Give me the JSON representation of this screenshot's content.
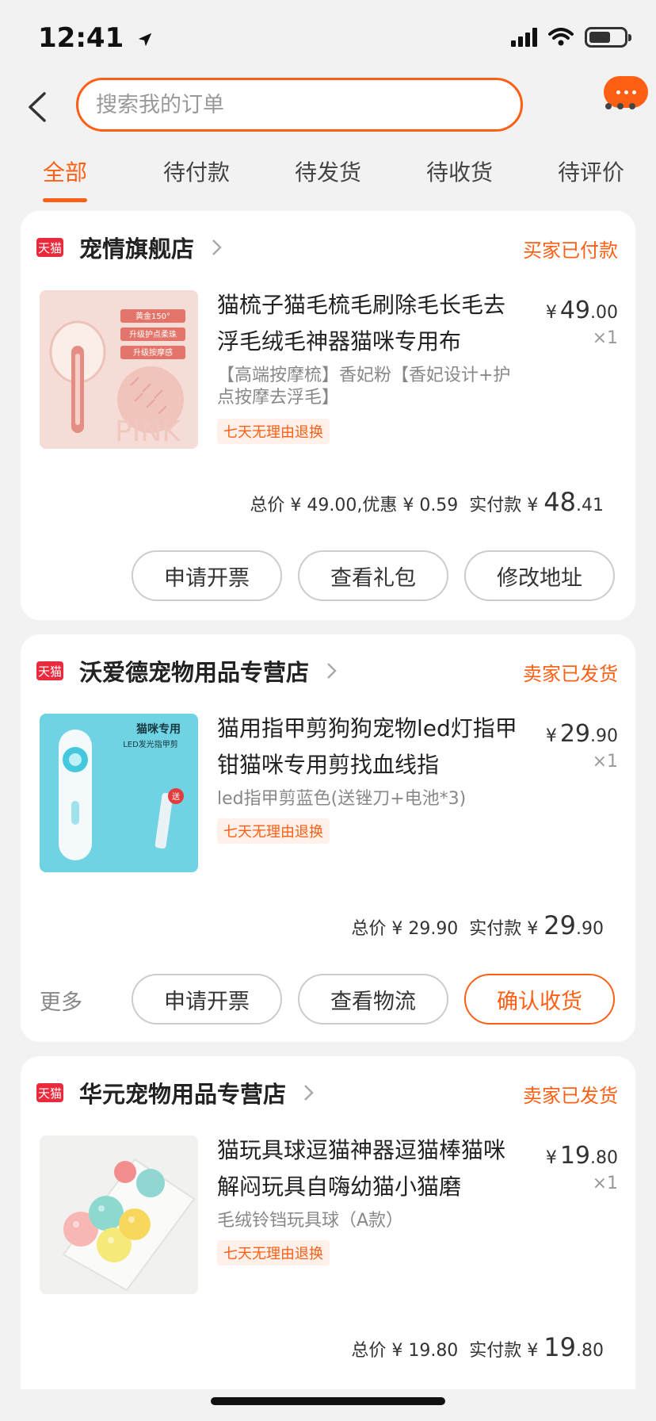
{
  "status_bar": {
    "time": "12:41"
  },
  "search": {
    "placeholder": "搜索我的订单"
  },
  "tabs": [
    {
      "label": "全部",
      "active": true
    },
    {
      "label": "待付款",
      "active": false
    },
    {
      "label": "待发货",
      "active": false
    },
    {
      "label": "待收货",
      "active": false
    },
    {
      "label": "待评价",
      "active": false
    }
  ],
  "tmall_badge": "天猫",
  "orders": [
    {
      "shop_name": "宠情旗舰店",
      "status": "买家已付款",
      "product_title": "猫梳子猫毛梳毛刷除毛长毛去浮毛绒毛神器猫咪专用布",
      "product_spec": "【高端按摩梳】香妃粉【香妃设计+护点按摩去浮毛】",
      "return_policy": "七天无理由退换",
      "price_currency": "¥",
      "price_int": "49",
      "price_dec": ".00",
      "quantity": "×1",
      "total_text": "总价 ¥ 49.00,优惠 ¥ 0.59  实付款 ¥ ",
      "paid_int": "48",
      "paid_dec": ".41",
      "actions": [
        "申请开票",
        "查看礼包",
        "修改地址"
      ],
      "image_labels": [
        "黄金150°",
        "升级护点柔珠",
        "升级按摩感",
        "PINK"
      ]
    },
    {
      "shop_name": "沃爱德宠物用品专营店",
      "status": "卖家已发货",
      "product_title": "猫用指甲剪狗狗宠物led灯指甲钳猫咪专用剪找血线指",
      "product_spec": "led指甲剪蓝色(送锉刀+电池*3)",
      "return_policy": "七天无理由退换",
      "price_currency": "¥",
      "price_int": "29",
      "price_dec": ".90",
      "quantity": "×1",
      "total_text": "总价 ¥ 29.90  实付款 ¥ ",
      "paid_int": "29",
      "paid_dec": ".90",
      "more_label": "更多",
      "actions": [
        "申请开票",
        "查看物流",
        "确认收货"
      ],
      "image_labels": [
        "猫咪专用",
        "LED发光指甲剪",
        "送"
      ]
    },
    {
      "shop_name": "华元宠物用品专营店",
      "status": "卖家已发货",
      "product_title": "猫玩具球逗猫神器逗猫棒猫咪解闷玩具自嗨幼猫小猫磨",
      "product_spec": "毛绒铃铛玩具球（A款）",
      "return_policy": "七天无理由退换",
      "price_currency": "¥",
      "price_int": "19",
      "price_dec": ".80",
      "quantity": "×1",
      "total_text": "总价 ¥ 19.80  实付款 ¥ ",
      "paid_int": "19",
      "paid_dec": ".80"
    }
  ],
  "colors": {
    "accent": "#ff5f15",
    "tmall_red": "#e82a3c",
    "background": "#f2f2f2"
  }
}
